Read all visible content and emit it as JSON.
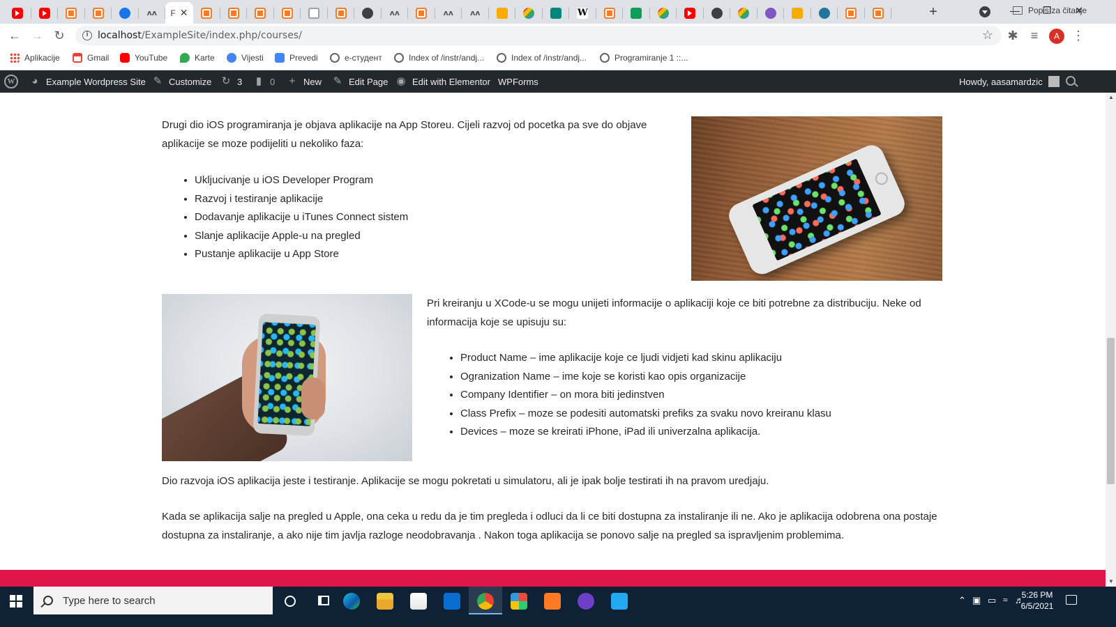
{
  "browser": {
    "tabs": [
      {
        "icon": "youtube-icon"
      },
      {
        "icon": "youtube-icon"
      },
      {
        "icon": "xampp-icon"
      },
      {
        "icon": "xampp-icon"
      },
      {
        "icon": "bitwarden-icon"
      },
      {
        "icon": "mt-icon"
      },
      {
        "icon": "page-icon",
        "title": "F",
        "active": true
      },
      {
        "icon": "xampp-icon"
      },
      {
        "icon": "xampp-icon"
      },
      {
        "icon": "xampp-icon"
      },
      {
        "icon": "xampp-icon"
      },
      {
        "icon": "page-icon"
      },
      {
        "icon": "xampp-icon"
      },
      {
        "icon": "compass-icon"
      },
      {
        "icon": "mt-icon"
      },
      {
        "icon": "xampp-icon"
      },
      {
        "icon": "mt-icon"
      },
      {
        "icon": "mt-icon"
      },
      {
        "icon": "photos-icon"
      },
      {
        "icon": "drive-icon"
      },
      {
        "icon": "docs-icon"
      },
      {
        "icon": "wikipedia-icon"
      },
      {
        "icon": "xampp-icon"
      },
      {
        "icon": "play-icon"
      },
      {
        "icon": "drive-icon"
      },
      {
        "icon": "youtube-icon"
      },
      {
        "icon": "globe-icon"
      },
      {
        "icon": "google-icon"
      },
      {
        "icon": "purple-icon"
      },
      {
        "icon": "chromium-icon"
      },
      {
        "icon": "wordpress-icon"
      },
      {
        "icon": "xampp-icon"
      },
      {
        "icon": "xampp-icon"
      }
    ],
    "active_tab_letter": "F",
    "new_tab": "+",
    "window_controls": {
      "minimize": "—",
      "restore": "❐",
      "close": "✕"
    },
    "url_host": "localhost",
    "url_path": "/ExampleSite/index.php/courses/",
    "profile_initial": "A",
    "bookmarks": [
      {
        "icon": "apps-icon",
        "label": "Aplikacije"
      },
      {
        "icon": "gmail-icon",
        "label": "Gmail"
      },
      {
        "icon": "youtube-icon",
        "label": "YouTube"
      },
      {
        "icon": "maps-icon",
        "label": "Karte"
      },
      {
        "icon": "news-icon",
        "label": "Vijesti"
      },
      {
        "icon": "translate-icon",
        "label": "Prevedi"
      },
      {
        "icon": "globe-icon",
        "label": "e-студент"
      },
      {
        "icon": "globe-icon",
        "label": "Index of /instr/andj..."
      },
      {
        "icon": "globe-icon",
        "label": "Index of /instr/andj..."
      },
      {
        "icon": "globe-icon",
        "label": "Programiranje 1 ::..."
      }
    ],
    "reading_list": "Popis za čitanje"
  },
  "wp_admin_bar": {
    "site_name": "Example Wordpress Site",
    "customize": "Customize",
    "updates_count": "3",
    "comments_count": "0",
    "new": "New",
    "edit_page": "Edit Page",
    "edit_elementor": "Edit with Elementor",
    "wpforms": "WPForms",
    "howdy": "Howdy, aasamardzic"
  },
  "content": {
    "intro": "Drugi dio iOS programiranja je objava aplikacije na App Storeu. Cijeli razvoj od pocetka pa sve do objave aplikacije se moze podijeliti u nekoliko faza:",
    "phases": [
      "Ukljucivanje u iOS Developer Program",
      "Razvoj i testiranje aplikacije",
      "Dodavanje aplikacije u iTunes Connect sistem",
      "Slanje aplikacije Apple-u na pregled",
      "Pustanje aplikacije u App Store"
    ],
    "xcode_intro": "Pri kreiranju u XCode-u se mogu unijeti informacije o aplikaciji koje ce biti potrebne za distribuciju. Neke od informacija koje se upisuju su:",
    "xcode_fields": [
      "Product Name – ime aplikacije koje ce ljudi vidjeti kad skinu aplikaciju",
      "Ogranization Name – ime koje se koristi kao opis organizacije",
      "Company Identifier – on mora biti jedinstven",
      "Class Prefix – moze se podesiti automatski prefiks za svaku novo kreiranu klasu",
      "Devices – moze se kreirati iPhone, iPad ili univerzalna aplikacija."
    ],
    "testing": "Dio razvoja iOS aplikacija jeste i testiranje. Aplikacije se mogu pokretati u simulatoru, ali je ipak bolje testirati ih na pravom uredjaju.",
    "review": "Kada se aplikacija salje na pregled u Apple, ona ceka u redu da je tim pregleda i odluci da li ce biti dostupna za instaliranje ili ne. Ako je aplikacija odobrena ona postaje dostupna za instaliranje, a ako nije tim javlja razloge neodobravanja . Nakon toga aplikacija se ponovo salje na pregled sa ispravljenim problemima.",
    "footer_color": "#e0164a"
  },
  "taskbar": {
    "search_placeholder": "Type here to search",
    "apps": [
      "edge-icon",
      "file-explorer-icon",
      "store-icon",
      "mail-icon",
      "chrome-icon",
      "colorful-app-icon",
      "xampp-icon",
      "github-icon",
      "vscode-icon"
    ],
    "time": "5:26 PM",
    "date": "6/5/2021"
  }
}
